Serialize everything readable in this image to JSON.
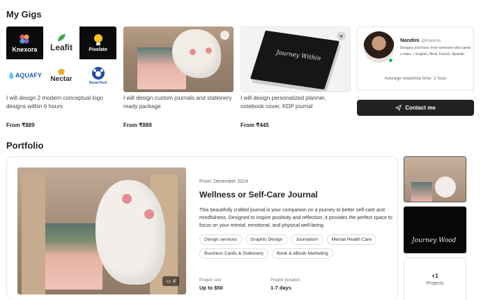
{
  "sections": {
    "gigs_title": "My Gigs",
    "portfolio_title": "Portfolio"
  },
  "gigs": [
    {
      "description": "I will design 2 modern conceptual logo designs within 6 hours",
      "price": "From ₹889",
      "logos": [
        "Knexora",
        "Leafit",
        "Pixelate",
        "AQUAFY",
        "Nectar",
        "RoverTech"
      ]
    },
    {
      "description": "I will design custom journals and stationery ready package",
      "price": "From ₹889",
      "icon": "heart-icon"
    },
    {
      "description": "I will design personalized planner, notebook cover, KDP journal",
      "price": "From ₹445",
      "icon": "heart-icon",
      "cover_text": "Journey Within"
    }
  ],
  "profile": {
    "name": "Nandini",
    "handle": "@knexora",
    "tagline": "Designs you'll love, from someone who cares!",
    "country": "India",
    "languages": "English, Hindi, French, Spanish",
    "response_time": "Average response time: 1 hour",
    "contact_label": "Contact me",
    "status_color": "#26b35a"
  },
  "portfolio": {
    "date": "From: December 2024",
    "title": "Wellness or Self-Care Journal",
    "description": "This beautifully crafted journal is your companion on a journey to better self-care and mindfulness. Designed to inspire positivity and reflection, it provides the perfect space to focus on your mental, emotional, and physical well-being.",
    "tags": [
      "Design services",
      "Graphic Design",
      "Journalism",
      "Mental Health Care",
      "Business Cards & Stationery",
      "Book & eBook Marketing"
    ],
    "image_count": "4",
    "cost_label": "Project cost",
    "cost_value": "Up to $50",
    "duration_label": "Project duration",
    "duration_value": "1-7 days",
    "side_dark_text": "Journey Wood",
    "more_count": "+1",
    "more_label": "Projects"
  }
}
